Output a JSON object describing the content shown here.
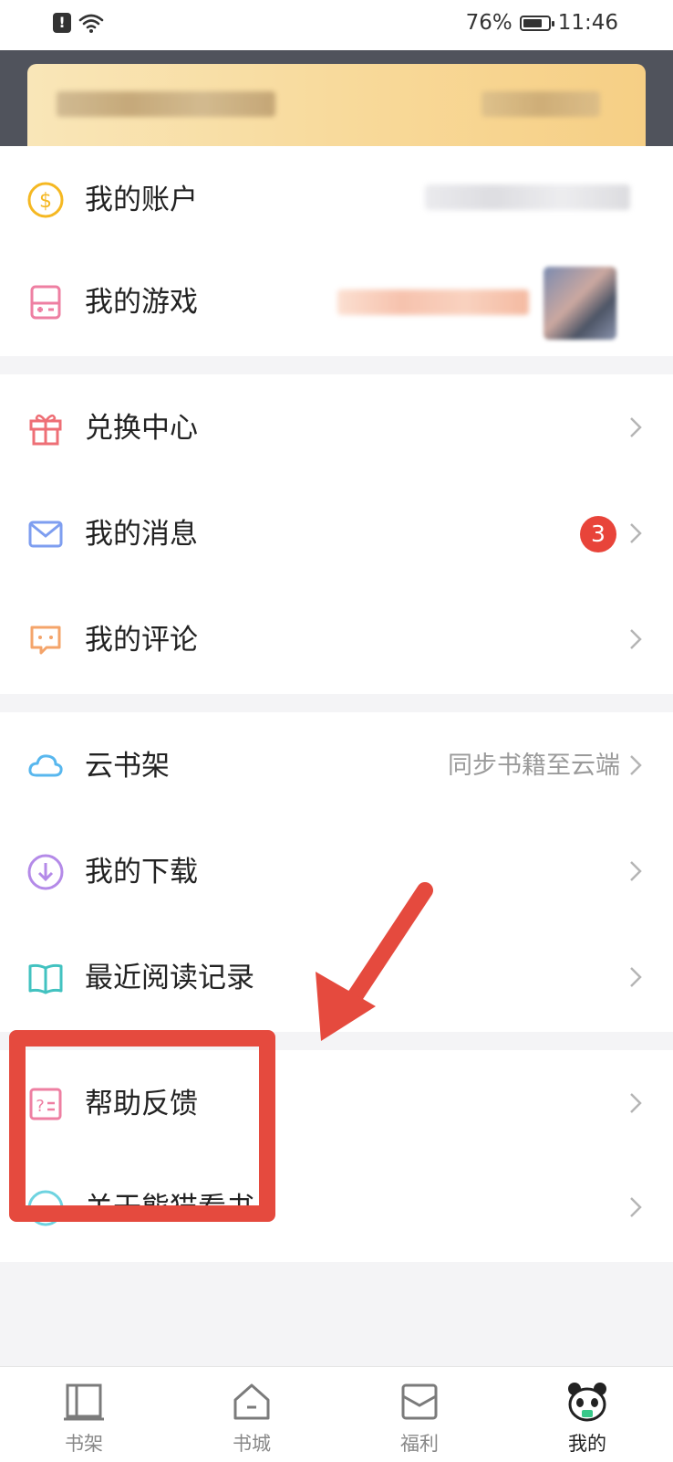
{
  "status_bar": {
    "battery_percent": "76%",
    "battery_level": 0.76,
    "time": "11:46",
    "alert_glyph": "!",
    "icons": [
      "alert-icon",
      "wifi-icon",
      "battery-icon"
    ]
  },
  "profile_card": {
    "content": "blurred"
  },
  "account_section": {
    "items": [
      {
        "icon": "dollar-coin-icon",
        "label": "我的账户"
      },
      {
        "icon": "game-console-icon",
        "label": "我的游戏"
      }
    ]
  },
  "activity_section": {
    "items": [
      {
        "icon": "gift-icon",
        "label": "兑换中心"
      },
      {
        "icon": "mail-icon",
        "label": "我的消息",
        "badge": "3"
      },
      {
        "icon": "comment-icon",
        "label": "我的评论"
      }
    ]
  },
  "library_section": {
    "items": [
      {
        "icon": "cloud-icon",
        "label": "云书架",
        "hint": "同步书籍至云端"
      },
      {
        "icon": "download-icon",
        "label": "我的下载"
      },
      {
        "icon": "book-icon",
        "label": "最近阅读记录"
      }
    ]
  },
  "help_section": {
    "items": [
      {
        "icon": "help-doc-icon",
        "label": "帮助反馈"
      },
      {
        "icon": "smile-icon",
        "label": "关于熊猫看书"
      }
    ]
  },
  "tabbar": {
    "tabs": [
      {
        "icon": "bookshelf-icon",
        "label": "书架"
      },
      {
        "icon": "home-icon",
        "label": "书城"
      },
      {
        "icon": "gift-box-icon",
        "label": "福利"
      },
      {
        "icon": "panda-icon",
        "label": "我的",
        "active": true
      }
    ]
  },
  "annotation": {
    "color": "#e54a3e"
  }
}
